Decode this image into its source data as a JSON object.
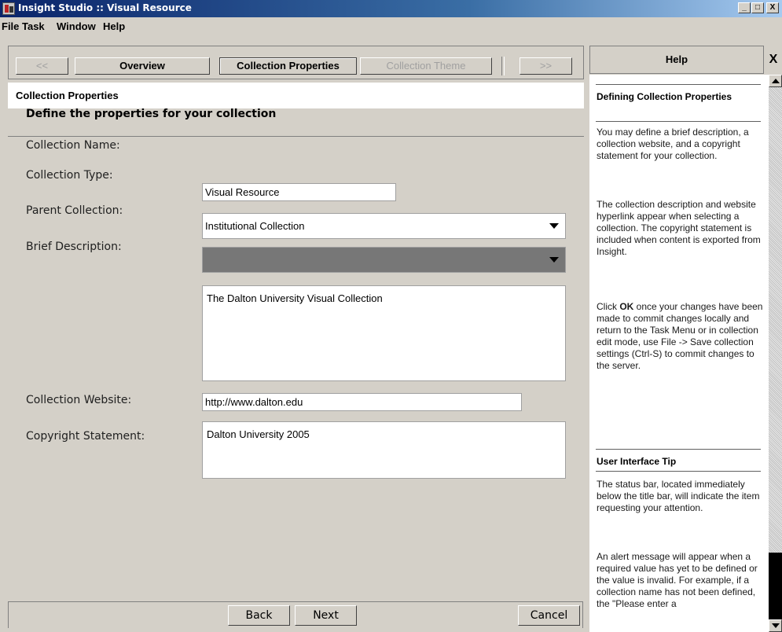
{
  "window": {
    "title": "Insight Studio :: Visual Resource",
    "minimize": "_",
    "maximize": "□",
    "close": "X"
  },
  "menu": [
    {
      "label": "File"
    },
    {
      "label": "Task"
    },
    {
      "label": "Window"
    },
    {
      "label": "Help"
    }
  ],
  "nav": {
    "prev": "<<",
    "overview": "Overview",
    "collection_properties": "Collection Properties",
    "collection_theme": "Collection Theme",
    "next": ">>"
  },
  "page": {
    "header": "Collection Properties",
    "heading": "Define the properties for your collection"
  },
  "form": {
    "collection_name": {
      "label": "Collection Name:",
      "value": "Visual Resource"
    },
    "collection_type": {
      "label": "Collection Type:",
      "value": "Institutional Collection"
    },
    "parent_collection": {
      "label": "Parent Collection:",
      "value": ""
    },
    "brief_description": {
      "label": "Brief Description:",
      "value": "The Dalton University Visual Collection"
    },
    "collection_website": {
      "label": "Collection Website:",
      "value": "http://www.dalton.edu"
    },
    "copyright_statement": {
      "label": "Copyright Statement:",
      "value": "Dalton University 2005"
    }
  },
  "buttons": {
    "back": "Back",
    "next": "Next",
    "cancel": "Cancel"
  },
  "help": {
    "title": "Help",
    "close": "X",
    "section1_title": "Defining Collection Properties",
    "p1": "You may define a brief description, a collection website, and a copyright statement for your collection.",
    "p2": "The collection description and website hyperlink appear when selecting a collection. The copyright statement is included when content is exported from Insight.",
    "p3_pre": "Click ",
    "p3_bold": "OK",
    "p3_post": " once your changes have been made to commit changes locally and return to the Task Menu or in collection edit mode, use File -> Save collection settings (Ctrl-S) to commit changes to the server.",
    "section2_title": "User Interface Tip",
    "p4": "The status bar, located immediately below the title bar, will indicate the item requesting your attention.",
    "p5": "An alert message will appear when a required value has yet to be defined or the value is invalid. For example, if a collection name has not been defined, the \"Please enter a"
  }
}
